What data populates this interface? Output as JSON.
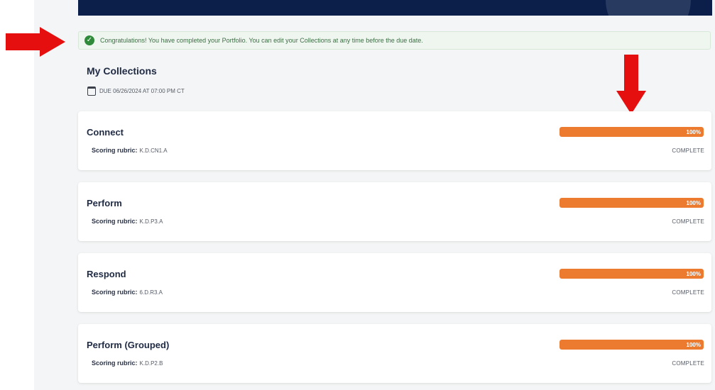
{
  "alert": {
    "message": "Congratulations! You have completed your Portfolio. You can edit your Collections at any time before the due date.",
    "color": "#2f8a3a"
  },
  "collections": {
    "title": "My Collections",
    "due": "DUE 06/26/2024 AT 07:00 PM CT",
    "rubric_label": "Scoring rubric:",
    "items": [
      {
        "name": "Connect",
        "rubric": "K.D.CN1.A",
        "progress": 100,
        "progress_label": "100%",
        "status": "COMPLETE"
      },
      {
        "name": "Perform",
        "rubric": "K.D.P3.A",
        "progress": 100,
        "progress_label": "100%",
        "status": "COMPLETE"
      },
      {
        "name": "Respond",
        "rubric": "6.D.R3.A",
        "progress": 100,
        "progress_label": "100%",
        "status": "COMPLETE"
      },
      {
        "name": "Perform (Grouped)",
        "rubric": "K.D.P2.B",
        "progress": 100,
        "progress_label": "100%",
        "status": "COMPLETE"
      }
    ]
  },
  "colors": {
    "banner": "#0c1f4a",
    "progress": "#ed7b2f",
    "annotation_arrow": "#e50f0f"
  }
}
